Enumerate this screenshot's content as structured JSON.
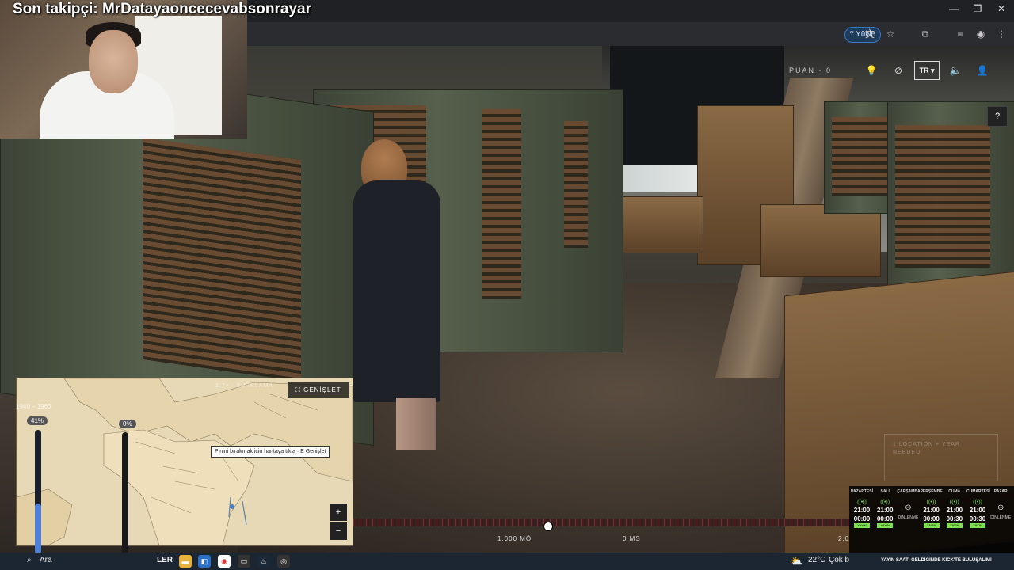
{
  "stream": {
    "follower_text": "Son takipçi: MrDatayaoncecevabsonrayar"
  },
  "browser": {
    "upload_label": "Yükle",
    "window_controls": [
      "minimize-icon",
      "restore-icon",
      "close-icon"
    ],
    "toolbar_icons": [
      "translate-icon",
      "star-icon",
      "extensions-icon",
      "media-icon",
      "profile-icon",
      "menu-icon"
    ]
  },
  "game": {
    "score_label": "PUAN · 0",
    "language": "TR",
    "help_label": "?",
    "hud_icons": [
      "lightbulb-icon",
      "hide-icon",
      "sound-icon",
      "user-icon"
    ],
    "needed_text": "1 LOCATION + YEAR NEEDED",
    "timeline": {
      "left_label": "1.000 MÖ",
      "center_label": "0 MS",
      "right_label": "2.0"
    },
    "map": {
      "expand_label": "GENİŞLET",
      "control_text": "2.7× · SIFIRLAMA",
      "tooltip": "Pinini bırakmak için haritaya tıkla · E Genişlet",
      "zoom_in": "+",
      "zoom_out": "−",
      "year_range": "1940 – 1960",
      "slider_left_pct": "41%",
      "slider_left_value": 41,
      "slider_right_pct": "0%",
      "slider_right_value": 0
    }
  },
  "schedule": {
    "days": [
      {
        "day": "PAZARTESİ",
        "active": true,
        "time": "21:00",
        "end": "00:00",
        "tag": "YAYIN"
      },
      {
        "day": "SALI",
        "active": true,
        "time": "21:00",
        "end": "00:00",
        "tag": "YAYIN"
      },
      {
        "day": "ÇARŞAMBA",
        "active": false,
        "off": "DİNLENME"
      },
      {
        "day": "PERŞEMBE",
        "active": true,
        "time": "21:00",
        "end": "00:00",
        "tag": "YAYIN"
      },
      {
        "day": "CUMA",
        "active": true,
        "time": "21:00",
        "end": "00:30",
        "tag": "YAYIN"
      },
      {
        "day": "CUMARTESİ",
        "active": true,
        "time": "21:00",
        "end": "00:30",
        "tag": "YAYIN"
      },
      {
        "day": "PAZAR",
        "active": false,
        "off": "DİNLENME"
      }
    ]
  },
  "taskbar": {
    "search_label": "Ara",
    "widget_label": "LER",
    "weather": "22°C",
    "weather_desc": "Çok b",
    "kick_banner": "YAYIN SAATİ GELDİĞİNDE KICK'TE BULUŞALIM!"
  }
}
